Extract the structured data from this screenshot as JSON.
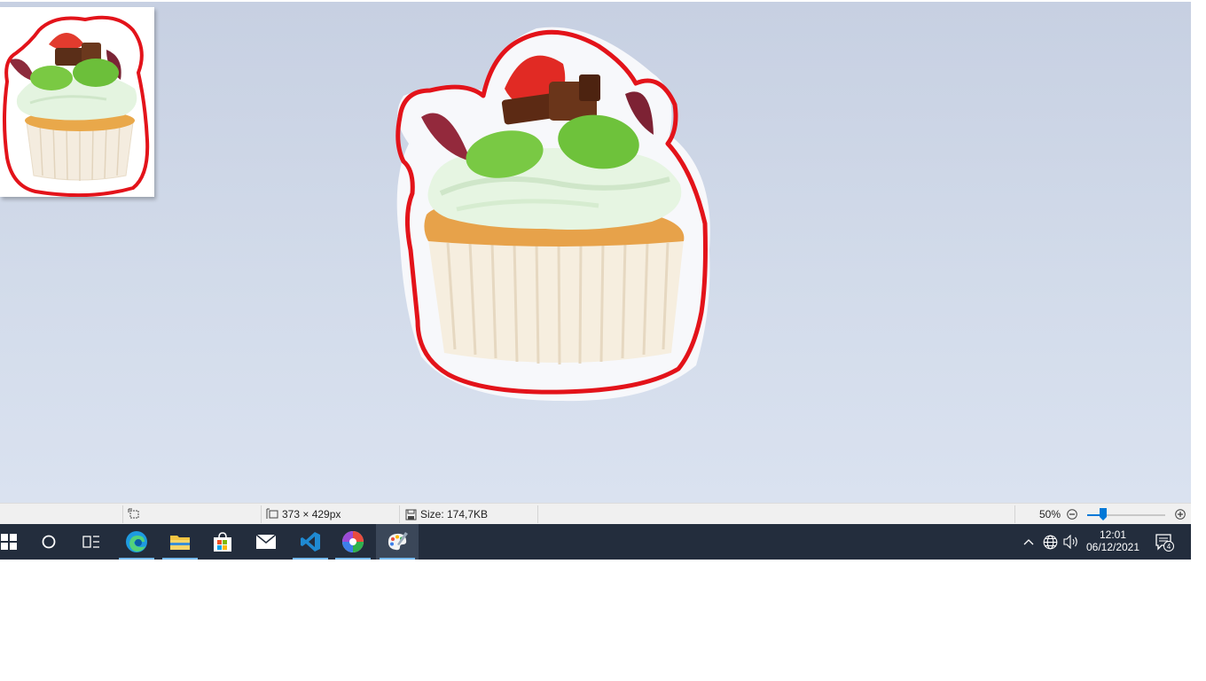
{
  "status_bar": {
    "selection_icon": "selection-icon",
    "dimensions_icon": "image-dimensions-icon",
    "dimensions": "373 × 429px",
    "size_icon": "disk-icon",
    "size": "Size: 174,7KB",
    "zoom_level": "50%",
    "zoom_fraction": 0.2
  },
  "taskbar": {
    "apps": [
      {
        "name": "start",
        "icon": "windows-logo-icon"
      },
      {
        "name": "search",
        "icon": "cortana-circle-icon"
      },
      {
        "name": "task-view",
        "icon": "task-view-icon"
      },
      {
        "name": "edge",
        "icon": "edge-icon",
        "running": true
      },
      {
        "name": "file-explorer",
        "icon": "folder-icon",
        "running": true
      },
      {
        "name": "store",
        "icon": "store-bag-icon"
      },
      {
        "name": "mail",
        "icon": "mail-icon"
      },
      {
        "name": "vscode",
        "icon": "vscode-icon",
        "running": true
      },
      {
        "name": "photos",
        "icon": "photos-icon",
        "running": true
      },
      {
        "name": "paint-3d",
        "icon": "paint-palette-icon",
        "active": true
      }
    ],
    "clock": {
      "time": "12:01",
      "date": "06/12/2021"
    },
    "notification_count": "4"
  },
  "colors": {
    "canvas_top": "#c7d0e2",
    "canvas_bottom": "#dae2f0",
    "taskbar": "#232d3d",
    "outline_red": "#e3131a",
    "accent_blue": "#0078d7"
  }
}
